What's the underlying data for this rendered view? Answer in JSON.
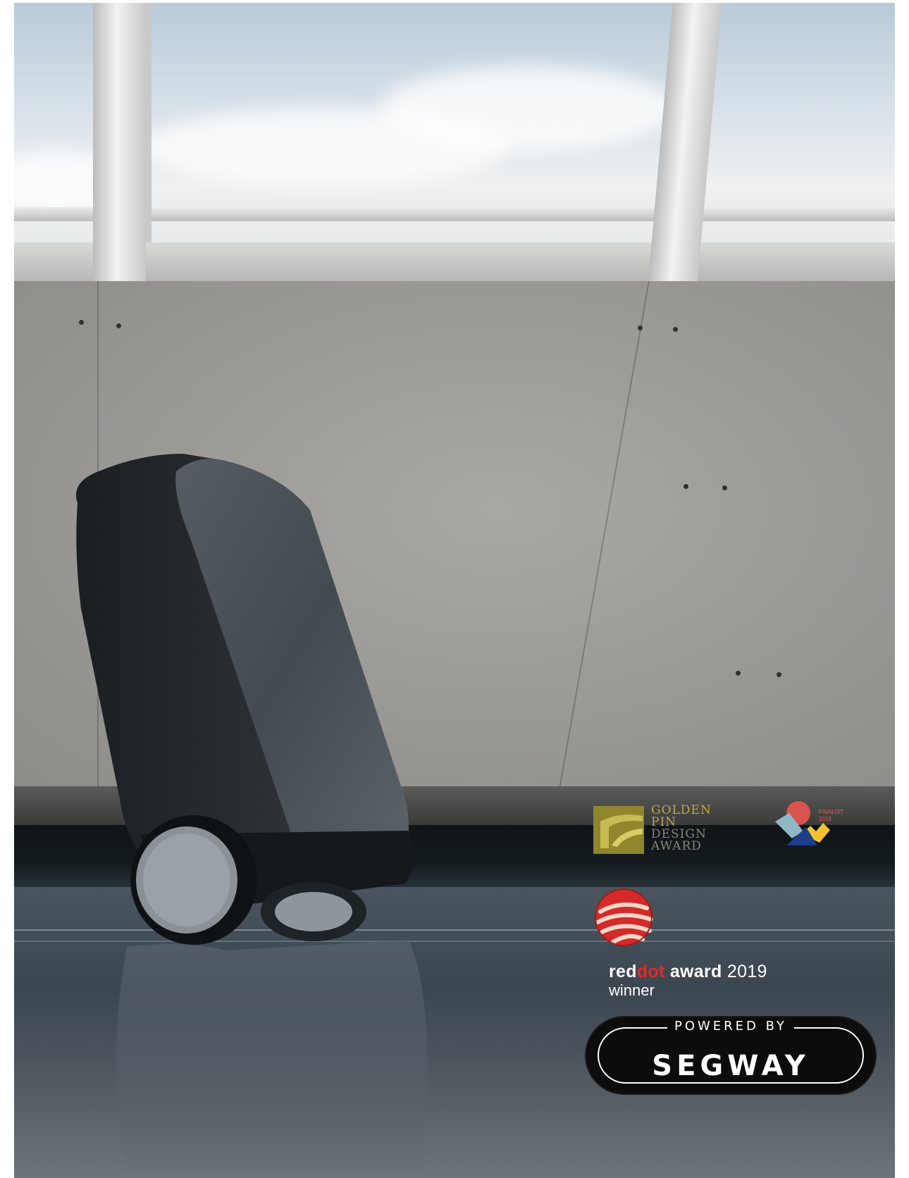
{
  "poster": {
    "scene": "robot suitcase",
    "colors": {
      "sky": "#d8e1e8",
      "wall": "#9c9b98",
      "floor": "#3c4650",
      "suitcase": "#2f3438"
    }
  },
  "awards": {
    "golden_pin": {
      "line1": "GOLDEN",
      "line2": "PIN",
      "line3": "DESIGN",
      "line4": "AWARD",
      "icon": "golden-pin-logo"
    },
    "finalist": {
      "line1": "FINALIST",
      "line2": "2019",
      "icon": "finalist-award-logo"
    },
    "reddot": {
      "icon": "reddot-logo",
      "word_red": "red",
      "word_dot": "dot",
      "word_award": "award",
      "year": "2019",
      "line2": "winner",
      "dot_color": "#e12a2a"
    }
  },
  "segway": {
    "small": "POWERED BY",
    "big": "SEGWAY"
  }
}
